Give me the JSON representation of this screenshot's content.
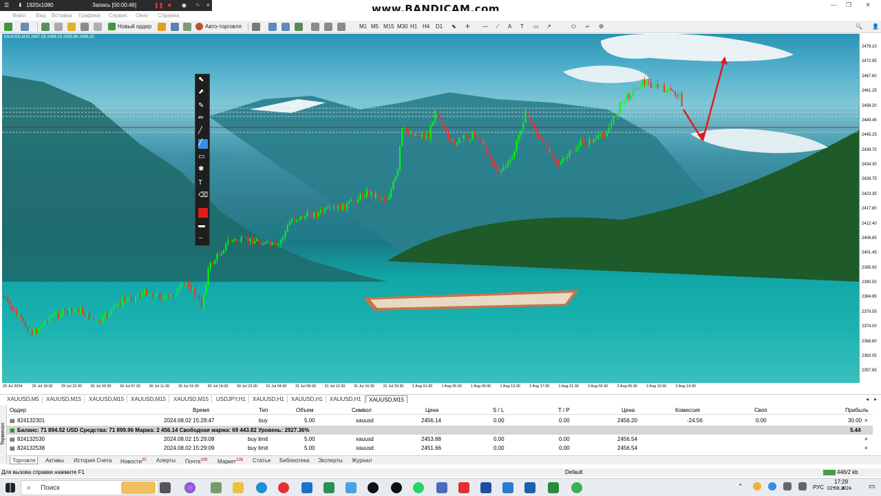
{
  "recorder": {
    "resolution": "1920x1080",
    "recording": "Запись [00:00:46]",
    "watermark": "www.BANDICAM.com"
  },
  "menu": [
    "Файл",
    "Вид",
    "Вставка",
    "Графики",
    "Сервис",
    "Окно",
    "Справка"
  ],
  "toolbar": {
    "new_order": "Новый ордер",
    "auto_trading": "Авто-торговля",
    "timeframes": [
      "M1",
      "M5",
      "M15",
      "M30",
      "H1",
      "H4",
      "D1"
    ]
  },
  "chart": {
    "symbol_info": "XAUUSD,M15  2457.59 2458.25 2455.86 2456.20",
    "price_ticks": [
      "2478.10",
      "2472.95",
      "2467.60",
      "2461.25",
      "2456.20",
      "2449.45",
      "2445.25",
      "2439.70",
      "2434.30",
      "2428.75",
      "2423.35",
      "2417.80",
      "2412.40",
      "2406.85",
      "2401.45",
      "2395.90",
      "2390.50",
      "2384.95",
      "2379.55",
      "2374.00",
      "2368.60",
      "2363.05",
      "2357.65"
    ],
    "time_ticks": [
      "29 Jul 2024",
      "29 Jul 18:30",
      "29 Jul 22:30",
      "30 Jul 03:30",
      "30 Jul 07:30",
      "30 Jul 11:30",
      "30 Jul 15:30",
      "30 Jul 19:30",
      "30 Jul 23:30",
      "31 Jul 04:30",
      "31 Jul 08:30",
      "31 Jul 12:30",
      "31 Jul 16:30",
      "31 Jul 20:30",
      "1 Aug 01:30",
      "1 Aug 05:30",
      "1 Aug 09:30",
      "1 Aug 13:30",
      "1 Aug 17:30",
      "1 Aug 21:30",
      "2 Aug 02:30",
      "2 Aug 06:30",
      "2 Aug 10:30",
      "2 Aug 14:30"
    ]
  },
  "chart_tabs": [
    "XAUUSD,M5",
    "XAUUSD,M15",
    "XAUUSD,M15",
    "XAUUSD,M15",
    "XAUUSD,M15",
    "USDJPY,H1",
    "XAUUSD,H1",
    "XAUUSD,H1",
    "XAUUSD,H1",
    "XAUUSD,M15"
  ],
  "terminal": {
    "side_label": "Терминал",
    "headers": {
      "order": "Ордер",
      "time": "Время",
      "type": "Тип",
      "volume": "Объем",
      "symbol": "Символ",
      "price": "Цена",
      "sl": "S / L",
      "tp": "T / P",
      "price2": "Цена",
      "commission": "Комиссия",
      "swap": "Своп",
      "profit": "Прибыль"
    },
    "rows": [
      {
        "order": "824132301",
        "time": "2024.08.02 15:28:47",
        "type": "buy",
        "volume": "5.00",
        "symbol": "xauusd",
        "price": "2456.14",
        "sl": "0.00",
        "tp": "0.00",
        "price2": "2456.20",
        "commission": "-24.56",
        "swap": "0.00",
        "profit": "30.00"
      },
      {
        "order": "824132530",
        "time": "2024.08.02 15:29:08",
        "type": "buy limit",
        "volume": "5.00",
        "symbol": "xauusd",
        "price": "2453.88",
        "sl": "0.00",
        "tp": "0.00",
        "price2": "2456.54"
      },
      {
        "order": "824132538",
        "time": "2024.08.02 15:29:09",
        "type": "buy limit",
        "volume": "5.00",
        "symbol": "xauusd",
        "price": "2451.66",
        "sl": "0.00",
        "tp": "0.00",
        "price2": "2456.54"
      }
    ],
    "balance_line": "Баланс: 71 894.52 USD  Средства: 71 899.96  Маржа: 2 456.14  Свободная маржа: 69 443.82  Уровень: 2927.36%",
    "balance_profit": "5.44",
    "tabs": [
      {
        "label": "Торговля",
        "badge": ""
      },
      {
        "label": "Активы",
        "badge": ""
      },
      {
        "label": "История Счета",
        "badge": ""
      },
      {
        "label": "Новости",
        "badge": "20"
      },
      {
        "label": "Алерты",
        "badge": ""
      },
      {
        "label": "Почта",
        "badge": "109"
      },
      {
        "label": "Маркет",
        "badge": "106"
      },
      {
        "label": "Статьи",
        "badge": ""
      },
      {
        "label": "Библиотека",
        "badge": ""
      },
      {
        "label": "Эксперты",
        "badge": ""
      },
      {
        "label": "Журнал",
        "badge": ""
      }
    ]
  },
  "status": {
    "help": "Для вызова справки нажмите F1",
    "profile": "Default",
    "traffic": "446/2 kb"
  },
  "taskbar": {
    "search": "Поиск",
    "lang": "РУС",
    "time": "17:29",
    "date": "02.08.2024"
  },
  "colors": {
    "candle_up": "#00ff00",
    "candle_down": "#ff2b2b",
    "arrow": "#e31b1b",
    "level_line": "#cc0000"
  }
}
